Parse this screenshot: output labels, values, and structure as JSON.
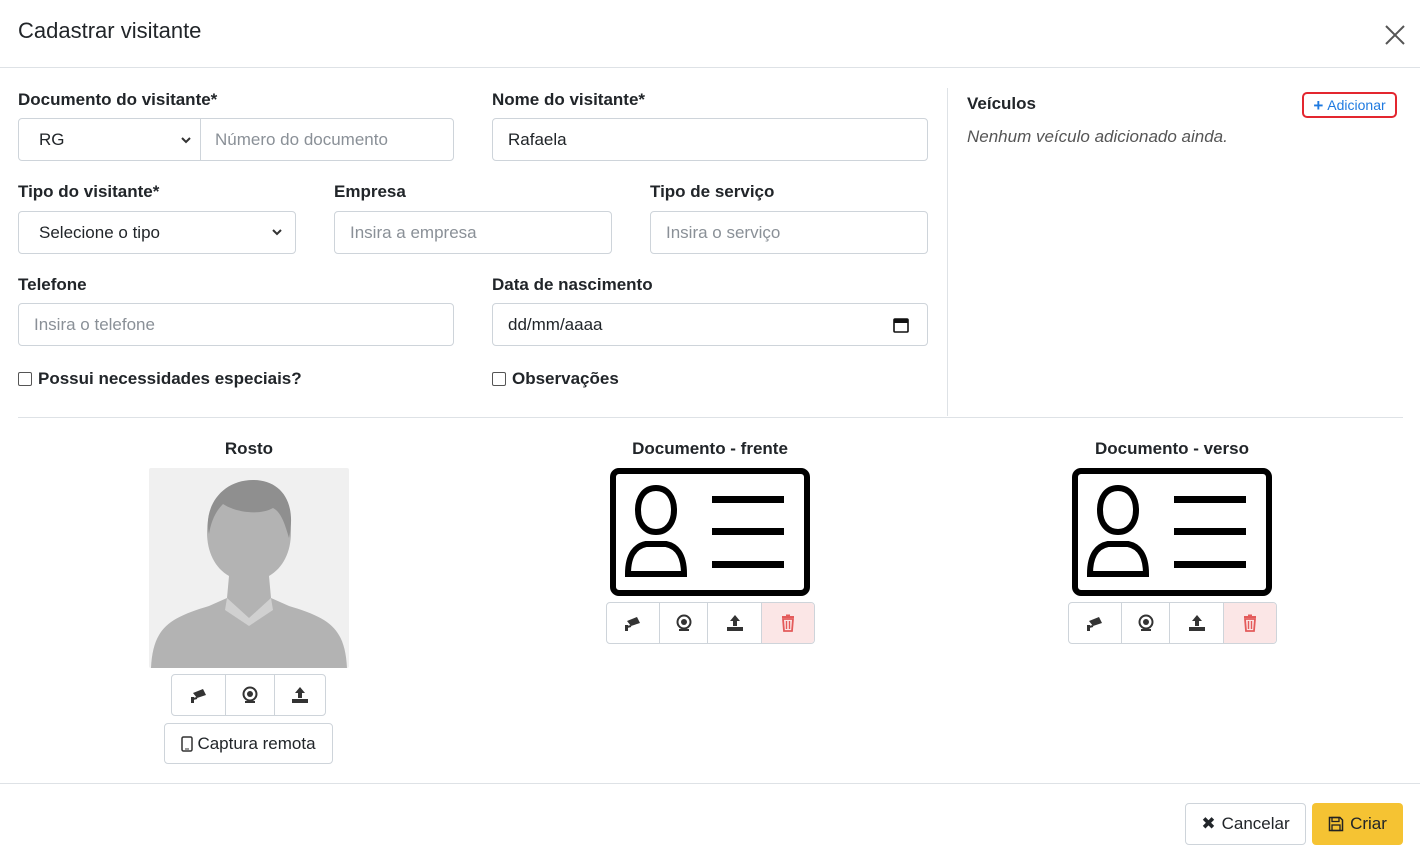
{
  "modal": {
    "title": "Cadastrar visitante"
  },
  "form": {
    "documento_label": "Documento do visitante*",
    "documento_type": "RG",
    "documento_placeholder": "Número do documento",
    "nome_label": "Nome do visitante*",
    "nome_value": "Rafaela",
    "tipo_label": "Tipo do visitante*",
    "tipo_value": "Selecione o tipo",
    "empresa_label": "Empresa",
    "empresa_placeholder": "Insira a empresa",
    "servico_label": "Tipo de serviço",
    "servico_placeholder": "Insira o serviço",
    "telefone_label": "Telefone",
    "telefone_placeholder": "Insira o telefone",
    "nascimento_label": "Data de nascimento",
    "nascimento_placeholder": "dd/mm/aaaa",
    "especiais_label": "Possui necessidades especiais?",
    "observacoes_label": "Observações"
  },
  "veiculos": {
    "title": "Veículos",
    "add_label": "Adicionar",
    "empty_text": "Nenhum veículo adicionado ainda."
  },
  "captures": {
    "rosto_title": "Rosto",
    "frente_title": "Documento - frente",
    "verso_title": "Documento - verso",
    "remote_label": "Captura remota"
  },
  "footer": {
    "cancel_label": "Cancelar",
    "create_label": "Criar"
  },
  "colors": {
    "accent_yellow": "#f5c333",
    "link_blue": "#1f7ae0",
    "highlight_red": "#e3262f",
    "delete_bg": "#fbe6e6"
  },
  "icons": [
    "close-icon",
    "chevron-down-icon",
    "calendar-icon",
    "plus-icon",
    "cctv-camera-icon",
    "webcam-icon",
    "upload-icon",
    "trash-icon",
    "tablet-icon",
    "times-icon",
    "save-icon"
  ]
}
